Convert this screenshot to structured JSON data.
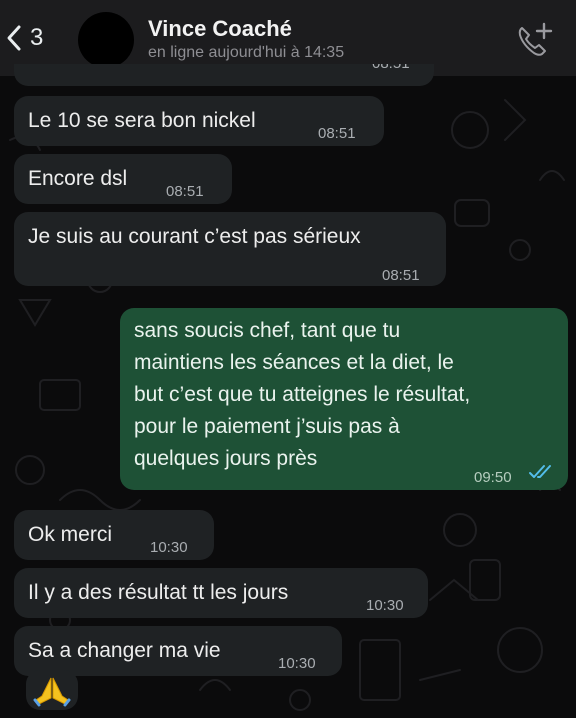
{
  "header": {
    "back_count": "3",
    "contact_name": "Vince Coaché",
    "status": "en ligne aujourd'hui à 14:35"
  },
  "messages": [
    {
      "direction": "in",
      "text": "Le 10 se sera bon nickel",
      "time": "08:51"
    },
    {
      "direction": "in",
      "text": "Encore dsl",
      "time": "08:51"
    },
    {
      "direction": "in",
      "text": "Je suis au courant c’est pas sérieux",
      "time": "08:51"
    },
    {
      "direction": "out",
      "text": [
        "sans soucis chef, tant que tu",
        "maintiens les séances et la diet, le",
        "but c’est que tu atteignes le résultat,",
        "pour le paiement j’suis pas à",
        "quelques jours près"
      ],
      "time": "09:50",
      "status": "read"
    },
    {
      "direction": "in",
      "text": "Ok merci",
      "time": "10:30"
    },
    {
      "direction": "in",
      "text": "Il y a des résultat tt les jours",
      "time": "10:30"
    },
    {
      "direction": "in",
      "text": "Sa a changer ma vie",
      "time": "10:30"
    },
    {
      "direction": "in",
      "emoji": "pray-emoji"
    }
  ],
  "partial_time": "08:51",
  "colors": {
    "incoming_bubble": "#1f2224",
    "outgoing_bubble": "#1e5136",
    "read_ticks": "#53bdeb",
    "background": "#0b0b0c"
  },
  "icons": [
    "back-chevron-icon",
    "add-call-icon",
    "pray-emoji",
    "double-check-icon"
  ]
}
